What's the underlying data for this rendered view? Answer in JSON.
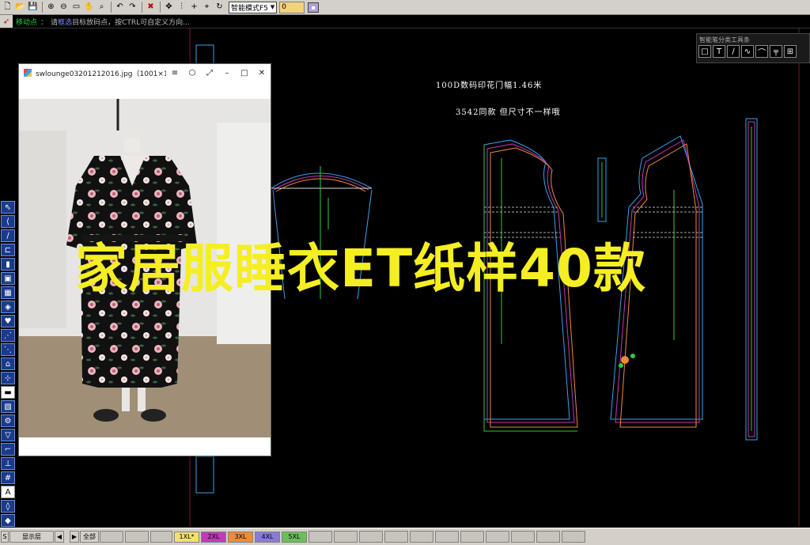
{
  "toolbar": {
    "icons": [
      "new-icon",
      "open-icon",
      "save-icon",
      "zoom-in-icon",
      "zoom-out-icon",
      "fit-icon",
      "pan-icon",
      "zoom-region-icon",
      "undo-icon",
      "redo-icon",
      "delete-icon",
      "move-icon",
      "align-icon",
      "add-icon",
      "measure-icon",
      "rotate-icon"
    ],
    "mode_select": "智能模式F5",
    "value": "0"
  },
  "status": {
    "mode": "移动点",
    "prefix": "请",
    "highlight": "框选",
    "suffix": "目标放码点，按CTRL可自定义方向..."
  },
  "smart_toolbar": {
    "title": "智能笔分类工具条",
    "buttons": [
      "□",
      "T",
      "∕",
      "∿",
      "⌒",
      "╤",
      "⊞"
    ]
  },
  "canvas": {
    "note_line1": "100D数码印花门幅1.46米",
    "note_line2": "3542同款    但尺寸不一样哦"
  },
  "viewer": {
    "title": "swlounge03201212016.jpg（1001×1...",
    "menu_icon": "≡",
    "shirt_icon": "⬡",
    "fullscreen_icon": "⤢",
    "min": "–",
    "max": "□",
    "close": "✕"
  },
  "headline": "家居服睡衣ET纸样40款",
  "bottom": {
    "s_label": "S",
    "layer_label": "显示层",
    "prev": "◀",
    "next": "▶",
    "all_label": "全部",
    "sizes": [
      {
        "label": "1XL*",
        "color": "#f2e26a"
      },
      {
        "label": "2XL",
        "color": "#c23ab8"
      },
      {
        "label": "3XL",
        "color": "#f08a3a"
      },
      {
        "label": "4XL",
        "color": "#8a7ad8"
      },
      {
        "label": "5XL",
        "color": "#6abf5a"
      }
    ]
  }
}
